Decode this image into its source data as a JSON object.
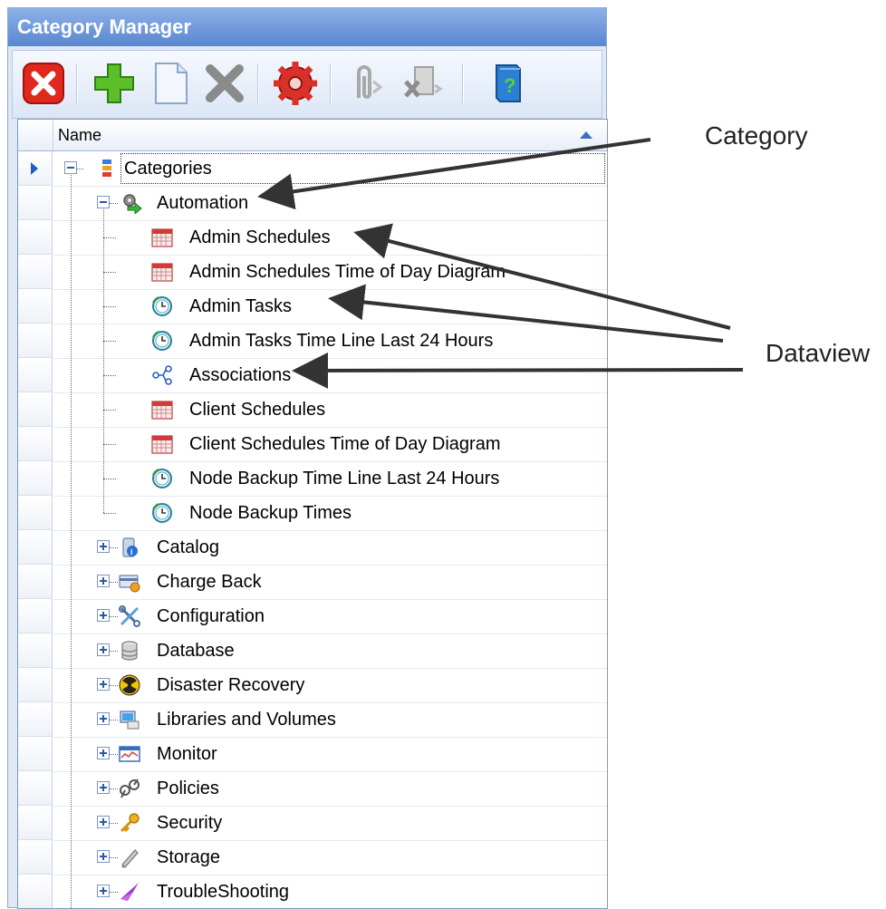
{
  "window": {
    "title": "Category Manager"
  },
  "toolbar": {
    "buttons": [
      {
        "name": "close-button",
        "icon": "red-x-icon"
      },
      {
        "name": "add-button",
        "icon": "green-plus-icon"
      },
      {
        "name": "new-button",
        "icon": "page-icon"
      },
      {
        "name": "delete-button",
        "icon": "gray-x-icon"
      },
      {
        "name": "settings-button",
        "icon": "red-gear-icon"
      },
      {
        "name": "attach-button",
        "icon": "paperclip-icon"
      },
      {
        "name": "remove-attachment-button",
        "icon": "remove-attachment-icon"
      },
      {
        "name": "help-button",
        "icon": "help-book-icon"
      }
    ]
  },
  "grid": {
    "column_header": "Name",
    "root": "Categories",
    "expanded_category": "Automation",
    "dataviews": [
      {
        "label": "Admin Schedules",
        "icon": "calendar-icon"
      },
      {
        "label": "Admin Schedules Time of Day Diagram",
        "icon": "calendar-icon"
      },
      {
        "label": "Admin Tasks",
        "icon": "clock-icon"
      },
      {
        "label": "Admin Tasks Time Line Last 24 Hours",
        "icon": "clock-icon"
      },
      {
        "label": "Associations",
        "icon": "association-icon"
      },
      {
        "label": "Client Schedules",
        "icon": "calendar-icon"
      },
      {
        "label": "Client Schedules Time of Day Diagram",
        "icon": "calendar-icon"
      },
      {
        "label": "Node Backup Time Line Last 24 Hours",
        "icon": "clock-icon"
      },
      {
        "label": "Node Backup Times",
        "icon": "clock-icon"
      }
    ],
    "categories": [
      {
        "label": "Catalog",
        "icon": "catalog-icon"
      },
      {
        "label": "Charge Back",
        "icon": "charge-back-icon"
      },
      {
        "label": "Configuration",
        "icon": "tools-icon"
      },
      {
        "label": "Database",
        "icon": "database-icon"
      },
      {
        "label": "Disaster Recovery",
        "icon": "radiation-icon"
      },
      {
        "label": "Libraries and Volumes",
        "icon": "library-icon"
      },
      {
        "label": "Monitor",
        "icon": "monitor-icon"
      },
      {
        "label": "Policies",
        "icon": "policies-icon"
      },
      {
        "label": "Security",
        "icon": "key-icon"
      },
      {
        "label": "Storage",
        "icon": "storage-icon"
      },
      {
        "label": "TroubleShooting",
        "icon": "troubleshooting-icon"
      }
    ]
  },
  "annotations": {
    "category": "Category",
    "dataview": "Dataview"
  },
  "colors": {
    "title_bar": "#5a86d0",
    "selection_arrow": "#1f5fbf",
    "annotation_arrow": "#333333"
  }
}
